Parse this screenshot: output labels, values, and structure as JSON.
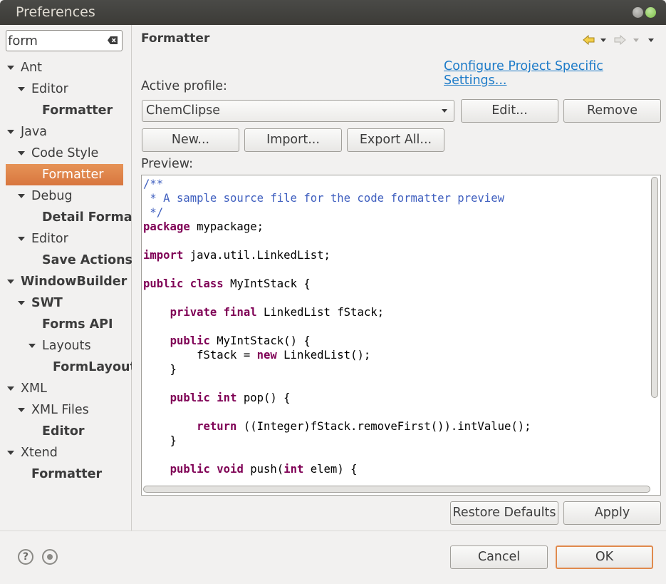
{
  "window": {
    "title": "Preferences"
  },
  "filter": {
    "value": "form"
  },
  "tree": [
    {
      "label": "Ant",
      "level": 0,
      "expanded": true,
      "bold": false
    },
    {
      "label": "Editor",
      "level": 1,
      "expanded": true,
      "bold": false
    },
    {
      "label": "Formatter",
      "level": 2,
      "expanded": false,
      "bold": true
    },
    {
      "label": "Java",
      "level": 0,
      "expanded": true,
      "bold": false
    },
    {
      "label": "Code Style",
      "level": 1,
      "expanded": true,
      "bold": false
    },
    {
      "label": "Formatter",
      "level": 2,
      "expanded": false,
      "bold": false,
      "selected": true
    },
    {
      "label": "Debug",
      "level": 1,
      "expanded": true,
      "bold": false
    },
    {
      "label": "Detail Forma",
      "level": 2,
      "expanded": false,
      "bold": true
    },
    {
      "label": "Editor",
      "level": 1,
      "expanded": true,
      "bold": false
    },
    {
      "label": "Save Actions",
      "level": 2,
      "expanded": false,
      "bold": true
    },
    {
      "label": "WindowBuilder",
      "level": 0,
      "expanded": true,
      "bold": true
    },
    {
      "label": "SWT",
      "level": 1,
      "expanded": true,
      "bold": true
    },
    {
      "label": "Forms API",
      "level": 2,
      "expanded": false,
      "bold": true
    },
    {
      "label": "Layouts",
      "level": 2,
      "expanded": true,
      "bold": false,
      "twisty": true
    },
    {
      "label": "FormLayout",
      "level": 3,
      "expanded": false,
      "bold": true
    },
    {
      "label": "XML",
      "level": 0,
      "expanded": true,
      "bold": false
    },
    {
      "label": "XML Files",
      "level": 1,
      "expanded": true,
      "bold": false
    },
    {
      "label": "Editor",
      "level": 2,
      "expanded": false,
      "bold": true
    },
    {
      "label": "Xtend",
      "level": 0,
      "expanded": true,
      "bold": false
    },
    {
      "label": "Formatter",
      "level": 1,
      "expanded": false,
      "bold": true,
      "leaf": true
    }
  ],
  "page": {
    "heading": "Formatter",
    "configure_link": "Configure Project Specific Settings...",
    "active_profile_label": "Active profile:",
    "profile_value": "ChemClipse",
    "edit_button": "Edit...",
    "remove_button": "Remove",
    "new_button": "New...",
    "import_button": "Import...",
    "export_button": "Export All...",
    "preview_label": "Preview:",
    "restore_defaults_button": "Restore Defaults",
    "apply_button": "Apply"
  },
  "code_lines": [
    [
      [
        "cm",
        "/**"
      ]
    ],
    [
      [
        "cm",
        " * A sample source file for the code formatter preview"
      ]
    ],
    [
      [
        "cm",
        " */"
      ]
    ],
    [
      [
        "kw",
        "package"
      ],
      [
        "",
        " mypackage;"
      ]
    ],
    [],
    [
      [
        "kw",
        "import"
      ],
      [
        "",
        " java.util.LinkedList;"
      ]
    ],
    [],
    [
      [
        "kw",
        "public"
      ],
      [
        "",
        " "
      ],
      [
        "kw",
        "class"
      ],
      [
        "",
        " MyIntStack {"
      ]
    ],
    [],
    [
      [
        "",
        "    "
      ],
      [
        "kw",
        "private"
      ],
      [
        "",
        " "
      ],
      [
        "kw",
        "final"
      ],
      [
        "",
        " LinkedList fStack;"
      ]
    ],
    [],
    [
      [
        "",
        "    "
      ],
      [
        "kw",
        "public"
      ],
      [
        "",
        " MyIntStack() {"
      ]
    ],
    [
      [
        "",
        "        fStack = "
      ],
      [
        "kw",
        "new"
      ],
      [
        "",
        " LinkedList();"
      ]
    ],
    [
      [
        "",
        "    }"
      ]
    ],
    [],
    [
      [
        "",
        "    "
      ],
      [
        "kw",
        "public"
      ],
      [
        "",
        " "
      ],
      [
        "kw",
        "int"
      ],
      [
        "",
        " pop() {"
      ]
    ],
    [],
    [
      [
        "",
        "        "
      ],
      [
        "kw",
        "return"
      ],
      [
        "",
        " ((Integer)fStack.removeFirst()).intValue();"
      ]
    ],
    [
      [
        "",
        "    }"
      ]
    ],
    [],
    [
      [
        "",
        "    "
      ],
      [
        "kw",
        "public"
      ],
      [
        "",
        " "
      ],
      [
        "kw",
        "void"
      ],
      [
        "",
        " push("
      ],
      [
        "kw",
        "int"
      ],
      [
        "",
        " elem) {"
      ]
    ]
  ],
  "footer": {
    "help_icon": "question-mark",
    "cancel_button": "Cancel",
    "ok_button": "OK"
  },
  "colors": {
    "selection": "#e08a4d",
    "keyword": "#7f0055",
    "comment": "#3f5fbf",
    "link": "#1d7bc8"
  }
}
